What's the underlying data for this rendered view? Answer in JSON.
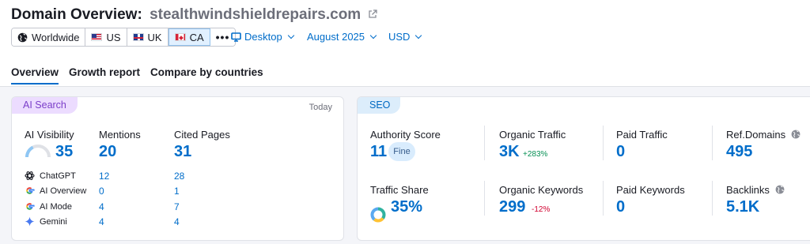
{
  "header": {
    "title_prefix": "Domain Overview:",
    "domain": "stealthwindshieldrepairs.com"
  },
  "databases": [
    {
      "label": "Worldwide",
      "icon": "globe-icon"
    },
    {
      "label": "US",
      "icon": "us-flag-icon"
    },
    {
      "label": "UK",
      "icon": "uk-flag-icon"
    },
    {
      "label": "CA",
      "icon": "ca-flag-icon",
      "active": true
    },
    {
      "label": "•••",
      "icon": "more-icon"
    }
  ],
  "selectors": {
    "device": "Desktop",
    "date": "August 2025",
    "currency": "USD"
  },
  "tabs": [
    "Overview",
    "Growth report",
    "Compare by countries"
  ],
  "ai_search": {
    "pill": "AI Search",
    "date_label": "Today",
    "visibility_label": "AI Visibility",
    "visibility_value": "35",
    "visibility_score": 35,
    "mentions_label": "Mentions",
    "mentions_value": "20",
    "cited_label": "Cited Pages",
    "cited_value": "31",
    "engines": [
      {
        "name": "ChatGPT",
        "mentions": "12",
        "cited": "28",
        "icon": "chatgpt-icon"
      },
      {
        "name": "AI Overview",
        "mentions": "0",
        "cited": "1",
        "icon": "google-icon"
      },
      {
        "name": "AI Mode",
        "mentions": "4",
        "cited": "7",
        "icon": "google-icon"
      },
      {
        "name": "Gemini",
        "mentions": "4",
        "cited": "4",
        "icon": "gemini-icon"
      }
    ]
  },
  "seo": {
    "pill": "SEO",
    "authority_label": "Authority Score",
    "authority_value": "11",
    "authority_badge": "Fine",
    "organic_traffic_label": "Organic Traffic",
    "organic_traffic_value": "3K",
    "organic_traffic_delta": "+283%",
    "paid_traffic_label": "Paid Traffic",
    "paid_traffic_value": "0",
    "ref_domains_label": "Ref.Domains",
    "ref_domains_value": "495",
    "traffic_share_label": "Traffic Share",
    "traffic_share_value": "35%",
    "organic_keywords_label": "Organic Keywords",
    "organic_keywords_value": "299",
    "organic_keywords_delta": "-12%",
    "paid_keywords_label": "Paid Keywords",
    "paid_keywords_value": "0",
    "backlinks_label": "Backlinks",
    "backlinks_value": "5.1K"
  },
  "colors": {
    "accent": "#006dca",
    "ai_pill_bg": "#ecdcff",
    "ai_pill_text": "#7b3ec9",
    "seo_pill_bg": "#dcedfb",
    "positive": "#079055",
    "negative": "#d1002f"
  }
}
